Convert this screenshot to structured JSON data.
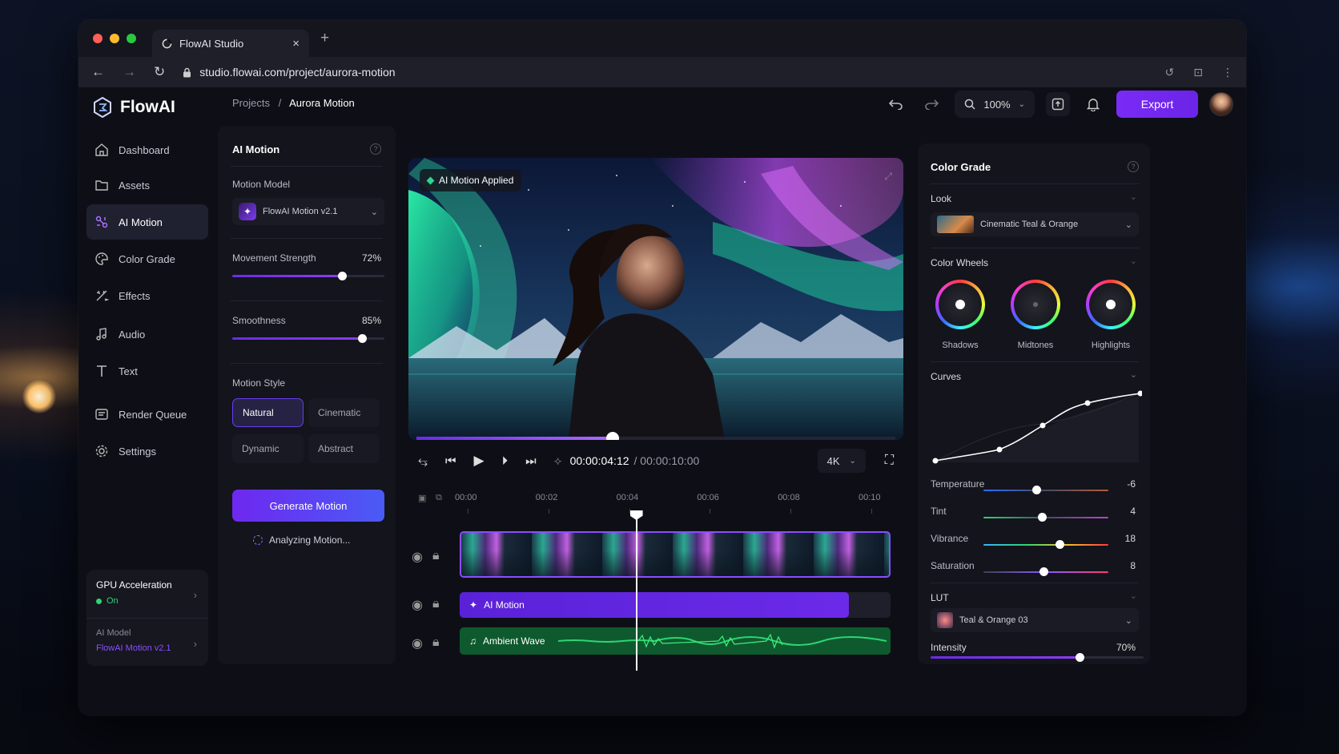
{
  "browser": {
    "tab_title": "FlowAI Studio",
    "url": "studio.flowai.com/project/aurora-motion"
  },
  "brand": {
    "name": "FlowAI",
    "accent": "#7a2bf5"
  },
  "sidebar": {
    "items": [
      {
        "label": "Dashboard",
        "icon": "home-icon"
      },
      {
        "label": "Assets",
        "icon": "folder-icon"
      },
      {
        "label": "AI Motion",
        "icon": "motion-icon",
        "active": true
      },
      {
        "label": "Color Grade",
        "icon": "palette-icon"
      },
      {
        "label": "Effects",
        "icon": "effects-icon"
      },
      {
        "label": "Audio",
        "icon": "audio-icon"
      },
      {
        "label": "Text",
        "icon": "text-icon"
      },
      {
        "label": "Render Queue",
        "icon": "render-queue-icon"
      },
      {
        "label": "Settings",
        "icon": "gear-icon"
      }
    ],
    "gpu_label": "GPU Acceleration",
    "gpu_status": "On",
    "model_label": "AI Model",
    "model_value": "FlowAI Motion v2.1"
  },
  "header": {
    "crumb_root": "Projects",
    "crumb_sep": "/",
    "crumb_current": "Aurora Motion",
    "zoom": "100%",
    "export_label": "Export"
  },
  "motion": {
    "title": "AI Motion",
    "model_label": "Motion Model",
    "model_value": "FlowAI Motion v2.1",
    "strength_label": "Movement Strength",
    "strength_value": "72%",
    "strength": 0.72,
    "smooth_label": "Smoothness",
    "smooth_value": "85%",
    "smooth": 0.85,
    "style_label": "Motion Style",
    "styles": [
      "Natural",
      "Cinematic",
      "Dynamic",
      "Abstract"
    ],
    "active_style": "Natural",
    "generate_label": "Generate Motion",
    "status": "Analyzing Motion..."
  },
  "preview": {
    "badge": "AI Motion Applied",
    "progress": 0.41,
    "current_time": "00:00:04:12",
    "total_time": "/ 00:00:10:00",
    "resolution": "4K"
  },
  "timeline": {
    "ticks": [
      "00:00",
      "00:02",
      "00:04",
      "00:06",
      "00:08",
      "00:10"
    ],
    "playhead": 0.41,
    "tracks": [
      {
        "type": "video"
      },
      {
        "label": "AI Motion",
        "type": "motion"
      },
      {
        "label": "Ambient Wave",
        "type": "audio"
      }
    ]
  },
  "color": {
    "title": "Color Grade",
    "look_label": "Look",
    "look_value": "Cinematic Teal & Orange",
    "wheels_label": "Color Wheels",
    "wheels": [
      "Shadows",
      "Midtones",
      "Highlights"
    ],
    "curves_label": "Curves",
    "adjust": [
      {
        "label": "Temperature",
        "value": "-6",
        "pos": 0.42
      },
      {
        "label": "Tint",
        "value": "4",
        "pos": 0.47
      },
      {
        "label": "Vibrance",
        "value": "18",
        "pos": 0.61
      },
      {
        "label": "Saturation",
        "value": "8",
        "pos": 0.48
      }
    ],
    "lut_label": "LUT",
    "lut_value": "Teal & Orange 03",
    "intensity_label": "Intensity",
    "intensity_value": "70%",
    "intensity": 0.7
  }
}
